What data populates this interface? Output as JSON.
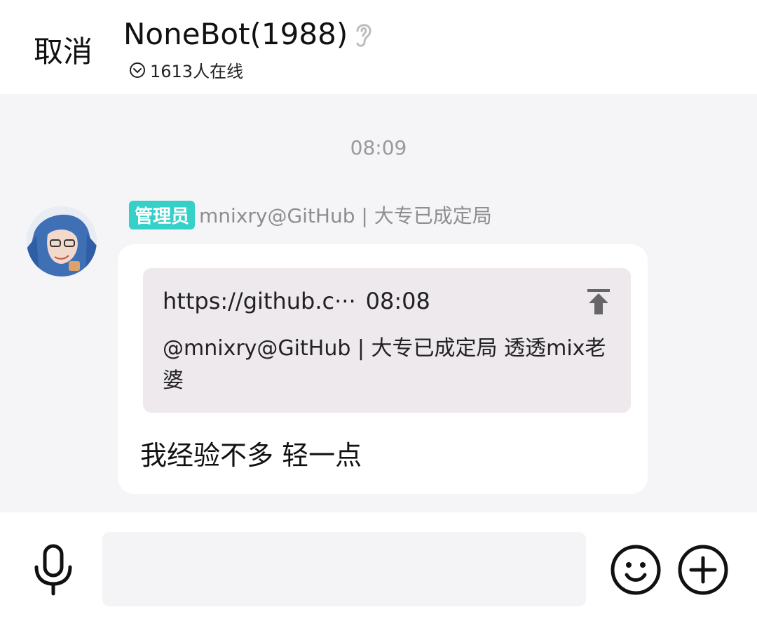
{
  "header": {
    "cancel_label": "取消",
    "title": "NoneBot(1988)",
    "online_text": "1613人在线"
  },
  "chat": {
    "timestamp": "08:09",
    "message": {
      "badge": "管理员",
      "sender": "mnixry@GitHub | 大专已成定局",
      "quote": {
        "source": "https://github.c···",
        "time": "08:08",
        "text": "@mnixry@GitHub | 大专已成定局 透透mix老婆"
      },
      "text": "我经验不多 轻一点"
    }
  },
  "input": {
    "placeholder": ""
  },
  "colors": {
    "badge": "#35d0c8",
    "chat_background": "#f5f4f6",
    "quote_background": "#ede9ec"
  },
  "icons": [
    "ear-icon",
    "online-status-icon",
    "quote-jump-icon",
    "mic-icon",
    "emoji-icon",
    "plus-icon"
  ]
}
